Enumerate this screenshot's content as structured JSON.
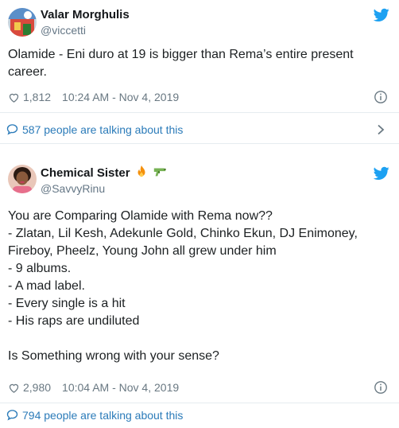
{
  "tweets": [
    {
      "display_name": "Valar Morghulis",
      "handle": "@viccetti",
      "text": "Olamide - Eni duro at 19 is bigger than Rema’s entire present career.",
      "likes": "1,812",
      "timestamp": "10:24 AM - Nov 4, 2019",
      "talking": "587 people are talking about this"
    },
    {
      "display_name": "Chemical Sister",
      "emojis": [
        "fire-emoji",
        "water-pistol-emoji"
      ],
      "handle": "@SavvyRinu",
      "text": "You are Comparing Olamide with Rema now??\n- Zlatan, Lil Kesh, Adekunle Gold, Chinko Ekun, DJ Enimoney, Fireboy, Pheelz, Young John all grew under him\n- 9 albums.\n- A mad label.\n- Every single is a hit\n- His raps are undiluted\n\nIs Something wrong with your sense?",
      "likes": "2,980",
      "timestamp": "10:04 AM - Nov 4, 2019",
      "talking": "794 people are talking about this"
    }
  ],
  "colors": {
    "twitter_blue": "#1da1f2",
    "link": "#2b7bb9",
    "muted": "#697882"
  }
}
